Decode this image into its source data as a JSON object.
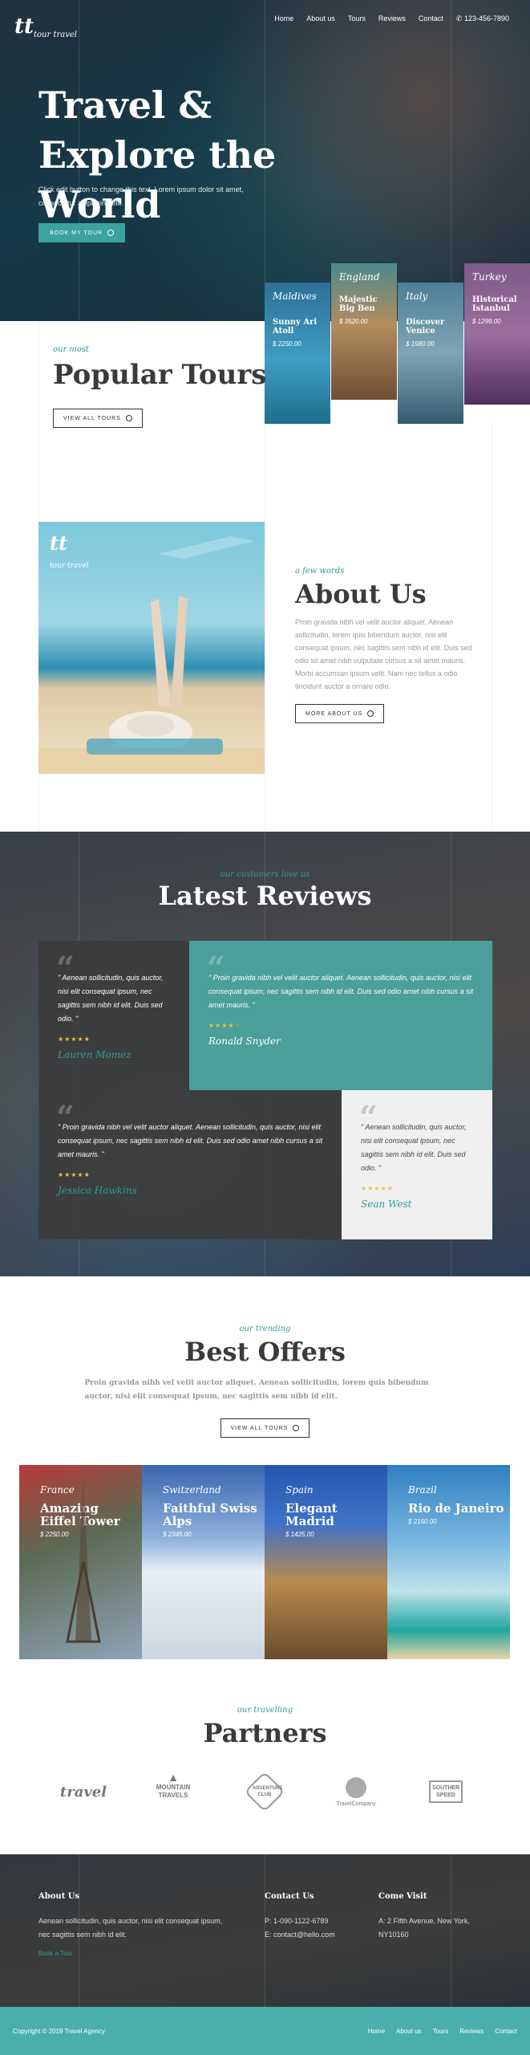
{
  "brand": {
    "mark": "tt",
    "name": "tour travel"
  },
  "nav": {
    "items": [
      "Home",
      "About us",
      "Tours",
      "Reviews",
      "Contact"
    ],
    "phone": "123-456-7890"
  },
  "hero": {
    "title": "Travel & Explore the World",
    "text": "Click edit button to change this text. Lorem ipsum dolor sit amet, consectetur adipiscing elit.",
    "button": "Book my tour"
  },
  "tours": [
    {
      "country": "Maldives",
      "name": "Sunny Ari Atoll",
      "price": "$ 2250.00",
      "color": "#3f95b8"
    },
    {
      "country": "England",
      "name": "Majestic Big Ben",
      "price": "$ 3520.00",
      "color": "#8b6a49"
    },
    {
      "country": "Italy",
      "name": "Discover Venice",
      "price": "$ 1980.00",
      "color": "#3b6a84"
    },
    {
      "country": "Turkey",
      "name": "Historical Istanbul",
      "price": "$ 1299.00",
      "color": "#6e4a78"
    }
  ],
  "popular": {
    "kicker": "our most",
    "title": "Popular Tours",
    "button": "View all tours"
  },
  "about": {
    "kicker": "a few words",
    "title": "About Us",
    "text": "Proin gravida nibh vel velit auctor aliquet. Aenean sollicitudin, lorem quis bibendum auctor, nisi elit consequat ipsum, nec sagittis sem nibh id elit. Duis sed odio sit amet nibh vulputate cursus a sit amet mauris. Morbi accumsan ipsum velit. Nam nec tellus a odio tincidunt auctor a ornare odio.",
    "button": "More about us",
    "image_badge": "tour travel"
  },
  "reviews": {
    "kicker": "our customers love us",
    "title": "Latest Reviews",
    "items": [
      {
        "text": "\" Aenean sollicitudin, quis auctor, nisi elit consequat ipsum, nec sagittis sem nibh id elit. Duis sed odio. \"",
        "stars": "★★★★★",
        "author": "Lauren Momez"
      },
      {
        "text": "\" Proin gravida nibh vel velit auctor aliquet. Aenean sollicitudin, quis auctor, nisi elit consequat ipsum, nec sagittis sem nibh id elit. Duis sed odio amet nibh cursus a sit amet mauris. \"",
        "stars": "★★★★☆",
        "author": "Ronald Snyder"
      },
      {
        "text": "\" Proin gravida nibh vel velit auctor aliquet. Aenean sollicitudin, quis auctor, nisi elit consequat ipsum, nec sagittis sem nibh id elit. Duis sed odio amet nibh cursus a sit amet mauris. \"",
        "stars": "★★★★★",
        "author": "Jessica Hawkins"
      },
      {
        "text": "\" Aenean sollicitudin, quis auctor, nisi elit consequat ipsum, nec sagittis sem nibh id elit. Duis sed odio. \"",
        "stars": "★★★★★",
        "author": "Sean West"
      }
    ]
  },
  "offers": {
    "kicker": "our trending",
    "title": "Best Offers",
    "text": "Proin gravida nibh vel velit auctor aliquet. Aenean sollicitudin, lorem quis bibendum auctor, nisi elit consequat ipsum, nec sagittis sem nibh id elit.",
    "button": "View all tours",
    "items": [
      {
        "country": "France",
        "name": "Amazing Eiffel Tower",
        "price": "$ 2250.00"
      },
      {
        "country": "Switzerland",
        "name": "Faithful Swiss Alps",
        "price": "$ 2345.00"
      },
      {
        "country": "Spain",
        "name": "Elegant Madrid",
        "price": "$ 1425.00"
      },
      {
        "country": "Brazil",
        "name": "Rio de Janeiro",
        "price": "$ 2150.00"
      }
    ]
  },
  "partners": {
    "kicker": "our travelling",
    "title": "Partners",
    "logos": [
      "travel",
      "MOUNTAIN TRAVELS",
      "ADVENTURE CLUB",
      "TravelCompany",
      "SOUTHER SPEED"
    ]
  },
  "footer": {
    "about_title": "About Us",
    "about_text": "Aenean sollicitudin, quis auctor, nisi elit consequat ipsum, nec sagittis sem nibh id elit.",
    "about_link": "Book a Tour",
    "contact_title": "Contact Us",
    "phone": "P: 1-090-1122-6789",
    "email": "E: contact@hello.com",
    "visit_title": "Come Visit",
    "address": "A: 2 Fifth Avenue, New York, NY10160"
  },
  "bottombar": {
    "copyright": "Copyright © 2019 Travel Agency",
    "links": [
      "Home",
      "About us",
      "Tours",
      "Reviews",
      "Contact"
    ]
  },
  "colors": {
    "accent": "#4aaeab",
    "dark": "#3a3a3a",
    "star": "#f0c23c",
    "review_teal": "#4a9f9b"
  }
}
